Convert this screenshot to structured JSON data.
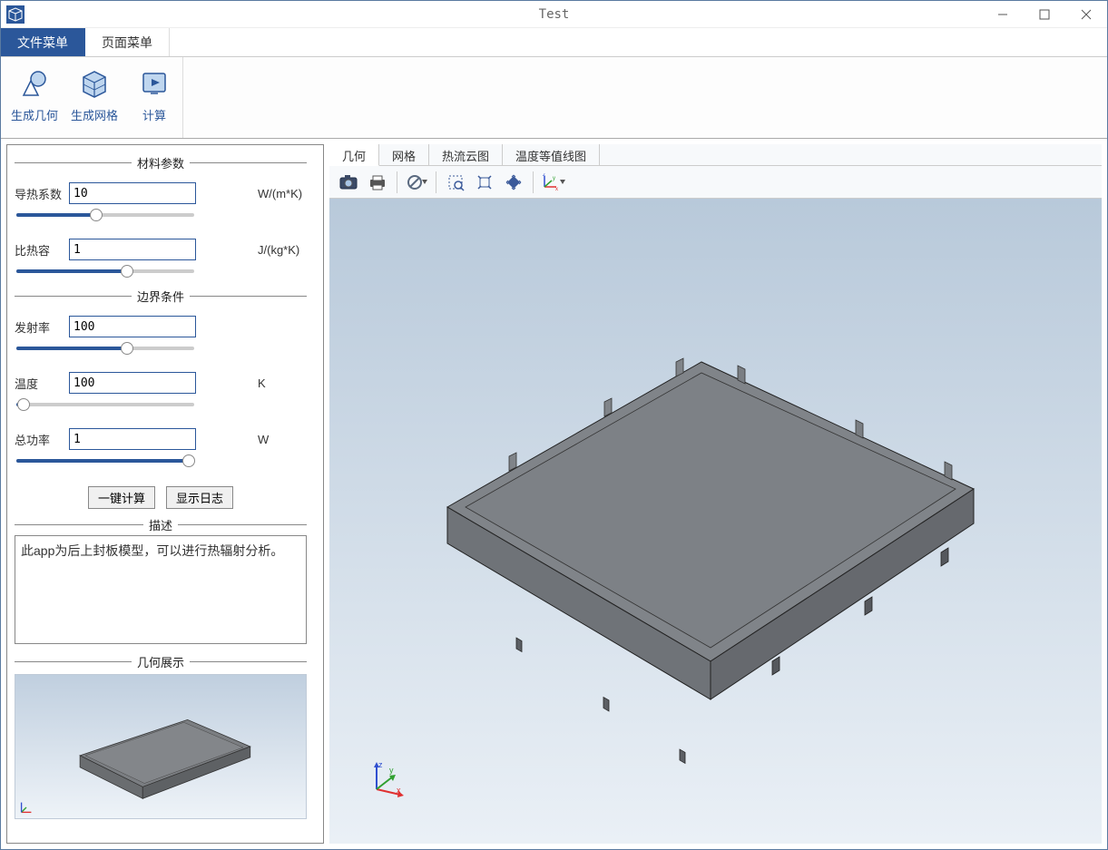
{
  "window": {
    "title": "Test"
  },
  "ribbon": {
    "tabs": {
      "file": "文件菜单",
      "page": "页面菜单"
    },
    "buttons": {
      "geom": "生成几何",
      "mesh": "生成网格",
      "calc": "计算"
    }
  },
  "sidebar": {
    "sections": {
      "material": "材料参数",
      "boundary": "边界条件",
      "description": "描述",
      "preview": "几何展示"
    },
    "params": {
      "k": {
        "label": "导热系数",
        "value": "10",
        "unit": "W/(m*K)",
        "slider_pct": 45
      },
      "cp": {
        "label": "比热容",
        "value": "1",
        "unit": "J/(kg*K)",
        "slider_pct": 62
      },
      "emiss": {
        "label": "发射率",
        "value": "100",
        "unit": "",
        "slider_pct": 62
      },
      "temp": {
        "label": "温度",
        "value": "100",
        "unit": "K",
        "slider_pct": 4
      },
      "power": {
        "label": "总功率",
        "value": "1",
        "unit": "W",
        "slider_pct": 97
      }
    },
    "buttons": {
      "calc_all": "一键计算",
      "show_log": "显示日志"
    },
    "description_text": "此app为后上封板模型，可以进行热辐射分析。"
  },
  "viewport": {
    "tabs": {
      "geom": "几何",
      "mesh": "网格",
      "flux": "热流云图",
      "iso": "温度等值线图"
    },
    "axes": {
      "x": "x",
      "y": "y",
      "z": "z"
    }
  },
  "colors": {
    "accent": "#2b579a",
    "axis_x": "#e03030",
    "axis_y": "#30a030",
    "axis_z": "#3050d0"
  }
}
